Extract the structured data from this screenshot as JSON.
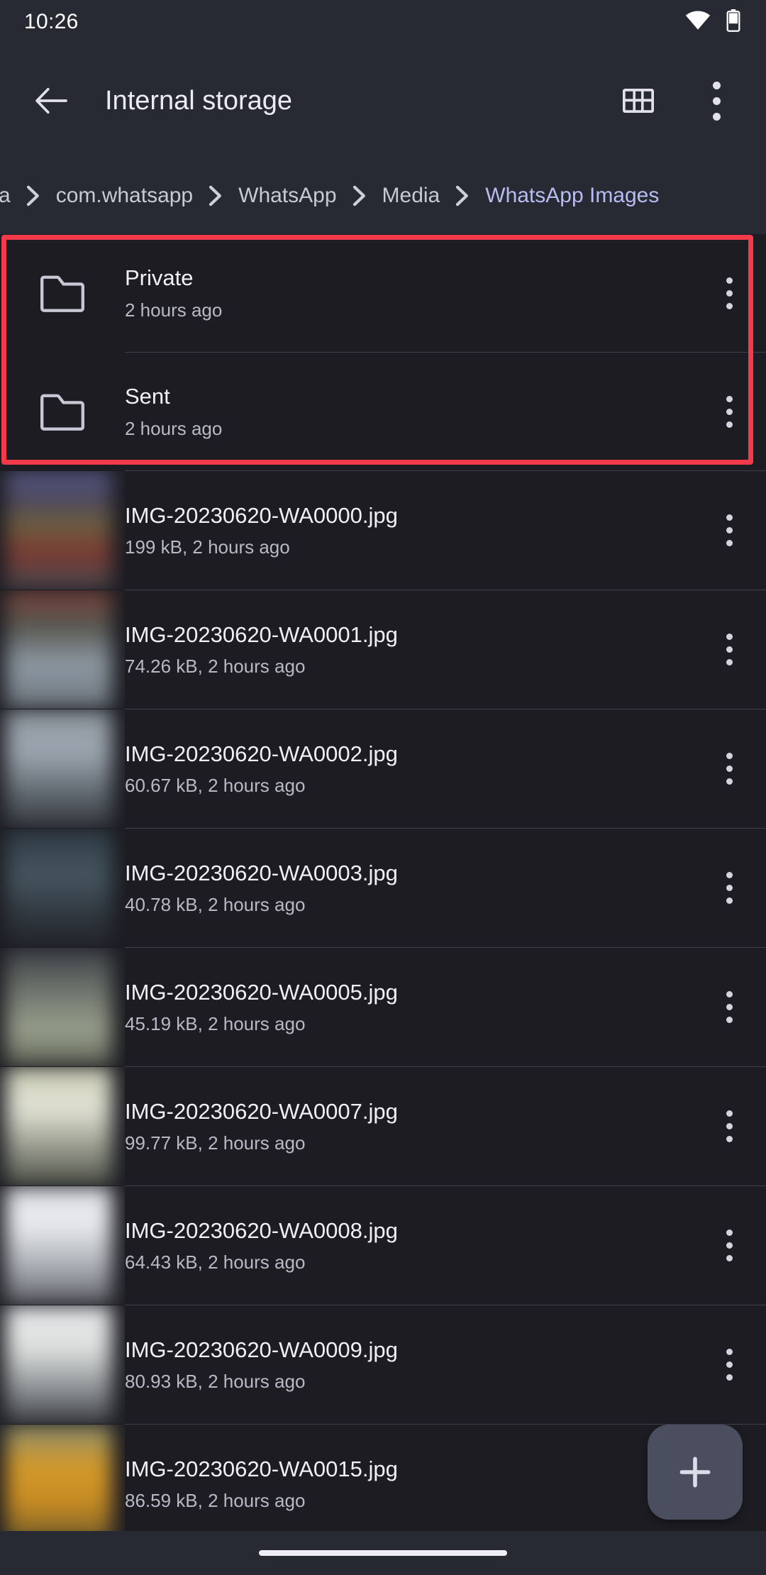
{
  "status_bar": {
    "clock": "10:26",
    "icons": [
      "wifi-icon",
      "battery-icon"
    ]
  },
  "app_bar": {
    "back_icon": "arrow-back-icon",
    "title": "Internal storage",
    "grid_view_icon": "grid-view-icon",
    "overflow_icon": "more-vert-icon"
  },
  "breadcrumb": {
    "items": [
      {
        "label": "a",
        "active": false
      },
      {
        "label": "com.whatsapp",
        "active": false
      },
      {
        "label": "WhatsApp",
        "active": false
      },
      {
        "label": "Media",
        "active": false
      },
      {
        "label": "WhatsApp Images",
        "active": true
      }
    ],
    "separator": "chevron-right-icon",
    "active_color": "#b8bcf0",
    "inactive_color": "#c9c9d4"
  },
  "highlight": {
    "color": "#f23a4b",
    "covers": [
      "Private",
      "Sent"
    ]
  },
  "folders": [
    {
      "name": "Private",
      "meta": "2 hours ago",
      "icon": "folder-icon"
    },
    {
      "name": "Sent",
      "meta": "2 hours ago",
      "icon": "folder-icon"
    }
  ],
  "files": [
    {
      "name": "IMG-20230620-WA0000.jpg",
      "meta": "199 kB, 2 hours ago",
      "size": "199 kB",
      "modified": "2 hours ago",
      "thumb": "linear-gradient(180deg,#5a5f8e 0%,#4a4560 22%,#6b6040 45%,#7d3a32 68%,#46484f 100%)"
    },
    {
      "name": "IMG-20230620-WA0001.jpg",
      "meta": "74.26 kB, 2 hours ago",
      "size": "74.26 kB",
      "modified": "2 hours ago",
      "thumb": "linear-gradient(180deg,#7a4038 0%,#55564f 30%,#8f9aa5 62%,#6c747c 100%)"
    },
    {
      "name": "IMG-20230620-WA0002.jpg",
      "meta": "60.67 kB, 2 hours ago",
      "size": "60.67 kB",
      "modified": "2 hours ago",
      "thumb": "linear-gradient(180deg,#8b949d 0%,#9fa8b2 35%,#596169 75%,#33383d 100%)"
    },
    {
      "name": "IMG-20230620-WA0003.jpg",
      "meta": "40.78 kB, 2 hours ago",
      "size": "40.78 kB",
      "modified": "2 hours ago",
      "thumb": "linear-gradient(180deg,#2e3a44 0%,#465660 40%,#2b3138 80%,#23272c 100%)"
    },
    {
      "name": "IMG-20230620-WA0005.jpg",
      "meta": "45.19 kB, 2 hours ago",
      "size": "45.19 kB",
      "modified": "2 hours ago",
      "thumb": "linear-gradient(180deg,#3b3f44 0%,#6e736c 35%,#9aa08c 70%,#5d6155 100%)"
    },
    {
      "name": "IMG-20230620-WA0007.jpg",
      "meta": "99.77 kB, 2 hours ago",
      "size": "99.77 kB",
      "modified": "2 hours ago",
      "thumb": "linear-gradient(180deg,#c9cbb4 0%,#e3e4d6 35%,#8e9184 72%,#4f5249 100%)"
    },
    {
      "name": "IMG-20230620-WA0008.jpg",
      "meta": "64.43 kB, 2 hours ago",
      "size": "64.43 kB",
      "modified": "2 hours ago",
      "thumb": "linear-gradient(180deg,#d9dade 0%,#eceef1 30%,#a7aab0 70%,#5b5e63 100%)"
    },
    {
      "name": "IMG-20230620-WA0009.jpg",
      "meta": "80.93 kB, 2 hours ago",
      "size": "80.93 kB",
      "modified": "2 hours ago",
      "thumb": "linear-gradient(180deg,#e6e7ea 0%,#dfe2e0 35%,#8a8d90 72%,#3e4145 100%)"
    },
    {
      "name": "IMG-20230620-WA0015.jpg",
      "meta": "86.59 kB, 2 hours ago",
      "size": "86.59 kB",
      "modified": "2 hours ago",
      "thumb": "linear-gradient(180deg,#8b8d70 0%,#d39a2a 35%,#c98c23 65%,#6d5a2a 100%)"
    }
  ],
  "row_menu_icon": "more-vert-icon",
  "fab": {
    "icon": "plus-icon",
    "color": "#4b4e5e"
  },
  "nav_bar": {
    "pill": "home-gesture-pill"
  }
}
